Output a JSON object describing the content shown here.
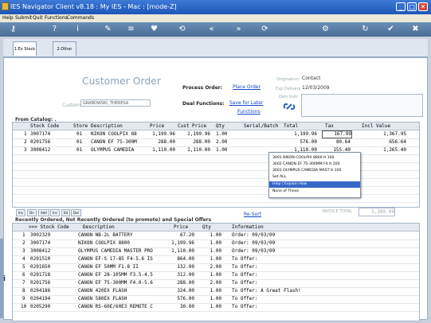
{
  "window": {
    "title": "IES Navigator Client v8.18 : My IES - Mac :     [mode-Z]"
  },
  "menu": [
    "Help",
    "Submit",
    "Quit",
    "Functions",
    "Commands"
  ],
  "toolbar": {
    "icons": [
      "key-icon",
      "help-icon",
      "info-icon",
      "edit-icon",
      "list-icon",
      "heart-icon",
      "back-icon",
      "back-alt-icon",
      "forward-icon",
      "forward-alt-icon",
      "settings-icon",
      "refresh-icon",
      "ok-icon",
      "cancel-icon"
    ]
  },
  "tabs": [
    {
      "label": "1.Ex Stock",
      "active": true
    },
    {
      "label": "2.Other",
      "active": false
    }
  ],
  "header": {
    "title": "Customer Order",
    "process_label": "Process Order:",
    "process_link": "Place Order",
    "deal_label": "Deal Functions:",
    "deal_link1": "Save for Later",
    "deal_link2": "Functions",
    "customer_label": "Customer",
    "customer_value": "GRABOWSKI, THERESA",
    "origination_label": "Origination",
    "origination_value": "Contact",
    "exp_delivery_label": "Exp Delivery",
    "exp_delivery_value": "12/03/2009",
    "delv_instr_label": "Delv Instr"
  },
  "catalog": {
    "title": "From Catalog: .",
    "columns": [
      "Stock Code",
      "Store",
      "Description",
      "Price",
      "Cust Price",
      "Qty",
      "Serial/Batch",
      "Total",
      "Tax",
      "Incl Value"
    ],
    "rows": [
      {
        "n": "1",
        "code": "3007174",
        "store": "01",
        "desc": "NIKON COOLPIX 88",
        "price": "1,199.96",
        "cust": "1,199.96",
        "qty": "1.00",
        "serial": "",
        "total": "1,199.96",
        "tax": "167.99",
        "incl": "1,367.95"
      },
      {
        "n": "2",
        "code": "0201756",
        "store": "01",
        "desc": "CANON EF 75-300M",
        "price": "288.00",
        "cust": "288.00",
        "qty": "2.00",
        "serial": "",
        "total": "576.00",
        "tax": "80.64",
        "incl": "656.64"
      },
      {
        "n": "3",
        "code": "3008412",
        "store": "01",
        "desc": "OLYMPUS CAMEDIA",
        "price": "1,110.00",
        "cust": "1,110.00",
        "qty": "1.00",
        "serial": "",
        "total": "1,110.00",
        "tax": "155.40",
        "incl": "1,265.40"
      }
    ],
    "invoice_total_label": "INVOICE TOTAL",
    "invoice_total_value": "3,289.99"
  },
  "context_menu": {
    "items": [
      "3001 NIKON COOLPIX 8800  It 100",
      "3002 CANON EF 75-300MM F4 It 100",
      "3003 OLYMPUS CAMEDIA MAST It 100",
      "Set ALL",
      "Help / Explain How",
      "None of These"
    ],
    "selected_index": 4
  },
  "mini_tabs": [
    "Ins",
    "Dn",
    "Add",
    "Inc",
    "Ed",
    "Del"
  ],
  "recent": {
    "title": "Recently Ordered, Not Recently Ordered (to promote) and Special Offers",
    "resort_link": "Re-Sort",
    "columns": [
      ">>> Stock Code",
      "Description",
      "Price",
      "Qty",
      "Information"
    ],
    "rows": [
      {
        "n": "1",
        "code": "3002329",
        "desc": "CANON NB-2L BATTERY",
        "price": "67.20",
        "qty": "1.00",
        "info": "Order: 09/03/09"
      },
      {
        "n": "2",
        "code": "3007174",
        "desc": "NIKON COOLPIX 8800",
        "price": "1,199.96",
        "qty": "1.00",
        "info": "Order: 09/03/09"
      },
      {
        "n": "3",
        "code": "3008412",
        "desc": "OLYMPUS CAMEDIA MASTER PRO",
        "price": "1,110.00",
        "qty": "1.00",
        "info": "Order: 09/03/09"
      },
      {
        "n": "4",
        "code": "0201510",
        "desc": "CANON EF-S 17-85 F4-5.6 IS",
        "price": "864.00",
        "qty": "1.00",
        "info": "To Offer:"
      },
      {
        "n": "5",
        "code": "0201650",
        "desc": "CANON EF 50MM F1.8 II",
        "price": "132.00",
        "qty": "2.00",
        "info": "To Offer:"
      },
      {
        "n": "6",
        "code": "0201718",
        "desc": "CANON EF 28-105MM F3.5-4.5",
        "price": "312.00",
        "qty": "1.00",
        "info": "To Offer:"
      },
      {
        "n": "7",
        "code": "0201756",
        "desc": "CANON EF 75-300MM F4.0-5.6",
        "price": "288.00",
        "qty": "2.00",
        "info": "To Offer:"
      },
      {
        "n": "8",
        "code": "0204186",
        "desc": "CANON 420EX FLASH",
        "price": "324.00",
        "qty": "1.00",
        "info": "To Offer: A Great Flash!"
      },
      {
        "n": "9",
        "code": "0204194",
        "desc": "CANON 580EX FLASH",
        "price": "576.00",
        "qty": "1.00",
        "info": "To Offer:"
      },
      {
        "n": "10",
        "code": "0205290",
        "desc": "CANON RS-60E/60E3 REMOTE C",
        "price": "30.00",
        "qty": "1.00",
        "info": "To Offer:"
      }
    ]
  },
  "colors": {
    "title_bar": "#1c56b8",
    "accent": "#3668c8",
    "link": "#1747c8"
  }
}
